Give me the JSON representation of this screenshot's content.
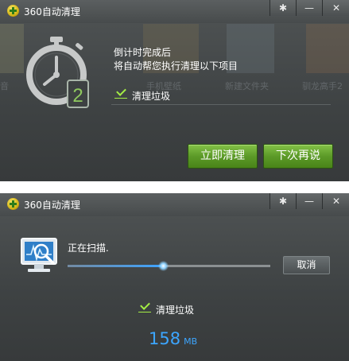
{
  "window1": {
    "title": "360自动清理",
    "controls": {
      "settings": "✱",
      "minimize": "—",
      "close": "✕"
    },
    "countdown_digit": "2",
    "message_line1": "倒计时完成后",
    "message_line2": "将自动帮您执行清理以下项目",
    "item_label": "清理垃圾",
    "item_checked": true,
    "background_labels": [
      "手机壁纸",
      "新建文件夹",
      "驯龙高手2"
    ],
    "buttons": {
      "clean_now": "立即清理",
      "next_time": "下次再说"
    }
  },
  "window2": {
    "title": "360自动清理",
    "controls": {
      "settings": "✱",
      "minimize": "—",
      "close": "✕"
    },
    "status": "正在扫描.",
    "progress": 0.47,
    "cancel_label": "取消",
    "item_label": "清理垃圾",
    "item_checked": true,
    "size_value": "158",
    "size_unit": "MB"
  },
  "colors": {
    "accent_green": "#5c9a28",
    "check_green": "#a4ed44",
    "scan_blue": "#3ca6ff",
    "window_bg": "#3e4243"
  },
  "icons": {
    "logo": "360-logo-icon",
    "settings": "gear-icon",
    "minimize": "minimize-icon",
    "close": "close-icon",
    "timer": "stopwatch-icon",
    "scan": "monitor-scan-icon",
    "check": "checkmark-icon"
  }
}
